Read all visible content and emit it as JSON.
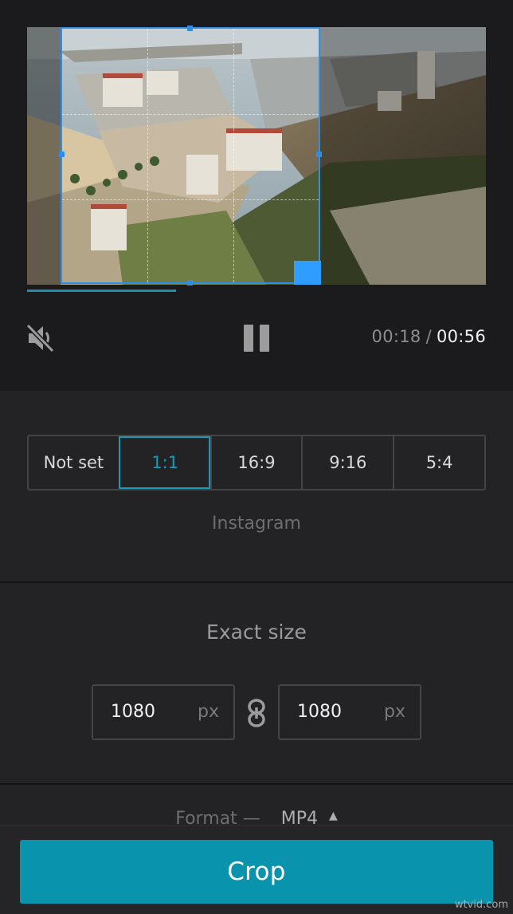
{
  "player": {
    "time_current": "00:18",
    "time_separator": "/",
    "time_total": "00:56",
    "progress_fraction": 0.325,
    "mute_icon": "volume-muted-icon",
    "pause_icon": "pause-icon"
  },
  "aspect": {
    "options": [
      "Not set",
      "1:1",
      "16:9",
      "9:16",
      "5:4"
    ],
    "selected": "1:1",
    "caption": "Instagram"
  },
  "exact_size": {
    "title": "Exact size",
    "width_value": "1080",
    "height_value": "1080",
    "unit": "px",
    "link_icon": "chain-link-icon"
  },
  "format": {
    "label": "Format —",
    "value": "MP4",
    "caret_icon": "caret-up-icon"
  },
  "actions": {
    "crop_label": "Crop"
  },
  "watermark": "wtvid.com",
  "colors": {
    "accent": "#0a93ad",
    "crop_frame": "#2f8fe8",
    "background": "#232325"
  }
}
